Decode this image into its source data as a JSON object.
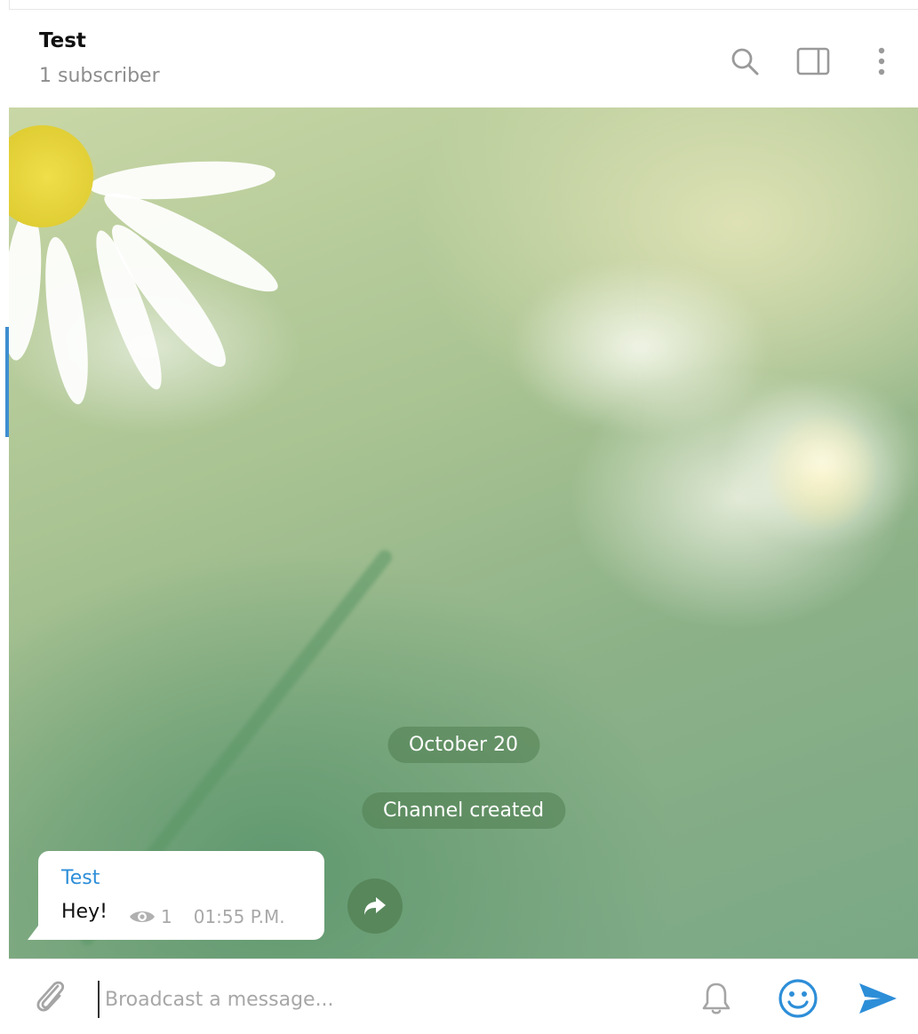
{
  "header": {
    "title": "Test",
    "subtitle": "1 subscriber",
    "icons": [
      "search-icon",
      "sidebar-panel-icon",
      "more-vertical-icon"
    ]
  },
  "chat": {
    "date_label": "October 20",
    "service_message": "Channel created",
    "message": {
      "author": "Test",
      "text": "Hey!",
      "views": "1",
      "time": "01:55 P.M."
    }
  },
  "composer": {
    "placeholder": "Broadcast a message...",
    "icons": [
      "paperclip-icon",
      "bell-icon",
      "smile-icon",
      "send-icon"
    ]
  },
  "colors": {
    "accent": "#3e8ed0",
    "author_name": "#2d8ed8",
    "service_pill": "#507d50"
  }
}
